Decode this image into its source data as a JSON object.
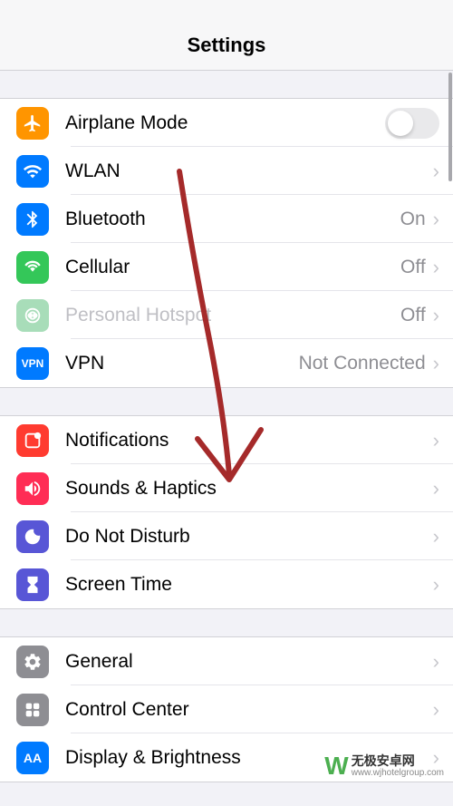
{
  "header": {
    "title": "Settings"
  },
  "groups": [
    {
      "rows": [
        {
          "icon": "airplane-icon",
          "iconBg": "bg-orange",
          "label": "Airplane Mode",
          "control": "toggle"
        },
        {
          "icon": "wifi-icon",
          "iconBg": "bg-blue",
          "label": "WLAN",
          "value": "",
          "control": "chevron"
        },
        {
          "icon": "bluetooth-icon",
          "iconBg": "bg-blue",
          "label": "Bluetooth",
          "value": "On",
          "control": "chevron"
        },
        {
          "icon": "cellular-icon",
          "iconBg": "bg-green",
          "label": "Cellular",
          "value": "Off",
          "control": "chevron"
        },
        {
          "icon": "hotspot-icon",
          "iconBg": "bg-green-dim",
          "label": "Personal Hotspot",
          "value": "Off",
          "control": "chevron",
          "dimmed": true
        },
        {
          "icon": "vpn-icon",
          "iconBg": "bg-blue",
          "label": "VPN",
          "value": "Not Connected",
          "control": "chevron",
          "iconText": "VPN"
        }
      ]
    },
    {
      "rows": [
        {
          "icon": "notifications-icon",
          "iconBg": "bg-red",
          "label": "Notifications",
          "control": "chevron"
        },
        {
          "icon": "sounds-icon",
          "iconBg": "bg-red-alt",
          "label": "Sounds & Haptics",
          "control": "chevron"
        },
        {
          "icon": "dnd-icon",
          "iconBg": "bg-purple",
          "label": "Do Not Disturb",
          "control": "chevron"
        },
        {
          "icon": "screentime-icon",
          "iconBg": "bg-indigo",
          "label": "Screen Time",
          "control": "chevron"
        }
      ]
    },
    {
      "rows": [
        {
          "icon": "general-icon",
          "iconBg": "bg-gray-gear",
          "label": "General",
          "control": "chevron"
        },
        {
          "icon": "control-center-icon",
          "iconBg": "bg-gray",
          "label": "Control Center",
          "control": "chevron"
        },
        {
          "icon": "display-icon",
          "iconBg": "bg-blue",
          "label": "Display & Brightness",
          "control": "chevron",
          "iconText": "AA"
        }
      ]
    }
  ],
  "watermark": {
    "title": "无极安卓网",
    "url": "www.wjhotelgroup.com"
  }
}
